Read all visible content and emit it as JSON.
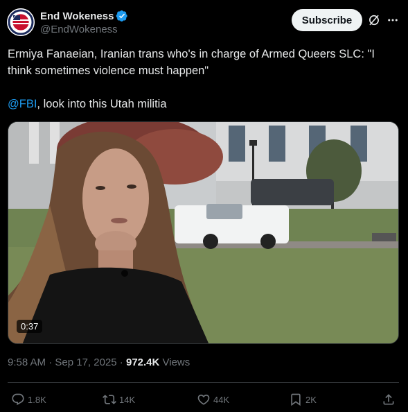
{
  "author": {
    "display_name": "End Wokeness",
    "handle": "@EndWokeness",
    "verified": true,
    "verified_color": "#1d9bf0"
  },
  "header": {
    "subscribe_label": "Subscribe",
    "grok_icon": "grok-icon",
    "more_icon": "more-icon"
  },
  "tweet": {
    "line1": "Ermiya Fanaeian, Iranian trans who's in charge of Armed Queers SLC: \"I think sometimes violence must happen\"",
    "mention": "@FBI",
    "line2_rest": ", look into this Utah militia"
  },
  "media": {
    "duration": "0:37"
  },
  "meta": {
    "time": "9:58 AM",
    "separator1": " · ",
    "date": "Sep 17, 2025",
    "separator2": " · ",
    "views_count": "972.4K",
    "views_label": " Views"
  },
  "actions": {
    "replies": "1.8K",
    "reposts": "14K",
    "likes": "44K",
    "bookmarks": "2K"
  },
  "colors": {
    "background": "#000000",
    "text": "#e7e9ea",
    "muted": "#71767b",
    "link": "#1d9bf0",
    "divider": "#2f3336"
  }
}
